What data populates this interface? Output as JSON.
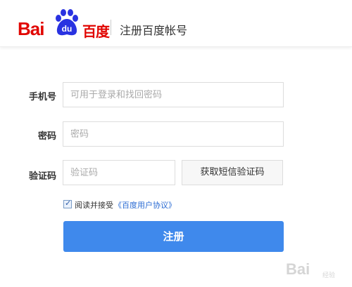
{
  "header": {
    "logo_latin": "Bai",
    "logo_paw_text": "du",
    "logo_chinese": "百度",
    "title": "注册百度帐号"
  },
  "form": {
    "phone": {
      "label": "手机号",
      "placeholder": "可用于登录和找回密码"
    },
    "password": {
      "label": "密码",
      "placeholder": "密码"
    },
    "code": {
      "label": "验证码",
      "placeholder": "验证码",
      "button": "获取短信验证码"
    },
    "agreement": {
      "checked": true,
      "text": "阅读并接受",
      "link": "《百度用户协议》"
    },
    "submit": "注册"
  },
  "watermark": {
    "text": "Bai",
    "sub": "经验"
  },
  "colors": {
    "brand_red": "#e10602",
    "primary_blue": "#3f89ec",
    "link_blue": "#2a6bd3"
  },
  "icons": {
    "logo": "baidu-paw-icon",
    "checkbox": "checkbox-checked-icon"
  }
}
